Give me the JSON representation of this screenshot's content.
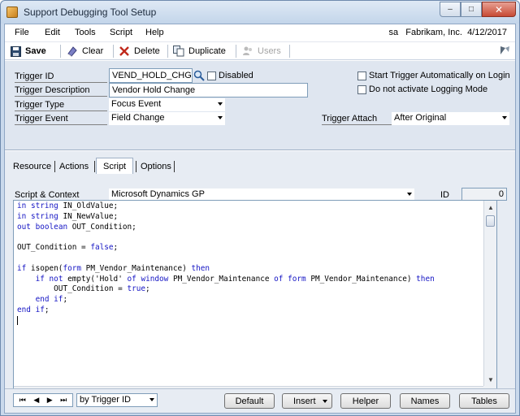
{
  "window": {
    "title": "Support Debugging Tool Setup",
    "min_glyph": "–",
    "max_glyph": "□",
    "close_glyph": "✕"
  },
  "menu": {
    "items": [
      "File",
      "Edit",
      "Tools",
      "Script",
      "Help"
    ],
    "user": "sa",
    "company": "Fabrikam, Inc.",
    "date": "4/12/2017"
  },
  "toolbar": {
    "save": "Save",
    "clear": "Clear",
    "delete": "Delete",
    "duplicate": "Duplicate",
    "users": "Users"
  },
  "form": {
    "trigger_id_label": "Trigger ID",
    "trigger_id_value": "VEND_HOLD_CHG",
    "disabled_label": "Disabled",
    "description_label": "Trigger Description",
    "description_value": "Vendor Hold Change",
    "type_label": "Trigger Type",
    "type_value": "Focus Event",
    "event_label": "Trigger Event",
    "event_value": "Field Change",
    "attach_label": "Trigger Attach",
    "attach_value": "After Original",
    "start_auto_label": "Start Trigger Automatically on Login",
    "no_logging_label": "Do not activate Logging Mode"
  },
  "tabs": [
    "Resource",
    "Actions",
    "Script",
    "Options"
  ],
  "active_tab": "Script",
  "script": {
    "context_label": "Script & Context",
    "context_value": "Microsoft Dynamics GP",
    "id_label": "ID",
    "id_value": "0"
  },
  "bottom": {
    "nav_first": "⏮",
    "nav_prev": "◀",
    "nav_next": "▶",
    "nav_last": "⏭",
    "sort_value": "by Trigger ID",
    "default": "Default",
    "insert": "Insert",
    "helper": "Helper",
    "names": "Names",
    "tables": "Tables"
  },
  "colors": {
    "keyword": "#1515c4",
    "title_bar": "#c9d9ec",
    "close_button": "#c74a34"
  }
}
